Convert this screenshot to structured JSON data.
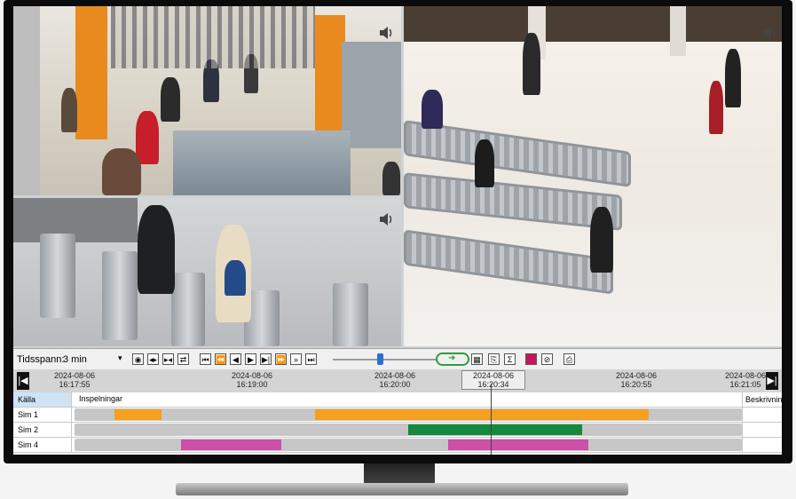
{
  "toolbar": {
    "timespan_label": "Tidsspann:",
    "timespan_value": "3 min",
    "colors": {
      "accent_green": "#2e9e3a",
      "slider_thumb": "#2b6fd6"
    }
  },
  "timeline": {
    "ticks": [
      {
        "date": "2024-08-06",
        "time": "16:17:55"
      },
      {
        "date": "2024-08-06",
        "time": "16:19:00"
      },
      {
        "date": "2024-08-06",
        "time": "16:20:00"
      },
      {
        "date": "2024-08-06",
        "time": "16:20:34"
      },
      {
        "date": "2024-08-06",
        "time": "16:20:55"
      },
      {
        "date": "2024-08-06",
        "time": "16:21:05"
      }
    ]
  },
  "grid": {
    "header_source": "Källa",
    "header_recordings": "Inspelningar",
    "header_description": "Beskrivning",
    "rows": [
      {
        "name": "Sim 1",
        "color": "#f5a020",
        "segments": [
          [
            0.06,
            0.13
          ],
          [
            0.36,
            0.86
          ]
        ]
      },
      {
        "name": "Sim 2",
        "color": "#138a3c",
        "segments": [
          [
            0.5,
            0.76
          ]
        ]
      },
      {
        "name": "Sim 4",
        "color": "#cc4fa8",
        "segments": [
          [
            0.16,
            0.31
          ],
          [
            0.56,
            0.77
          ]
        ]
      }
    ]
  }
}
